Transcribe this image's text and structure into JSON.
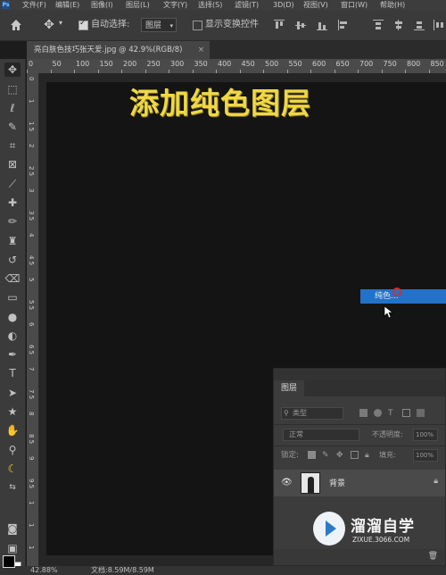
{
  "menubar": {
    "items": [
      "文件(F)",
      "编辑(E)",
      "图像(I)",
      "图层(L)",
      "文字(Y)",
      "选择(S)",
      "滤镜(T)",
      "3D(D)",
      "视图(V)",
      "窗口(W)",
      "帮助(H)"
    ]
  },
  "options": {
    "auto_select_label": "自动选择:",
    "auto_select_value": "图层",
    "transform_controls_label": "显示变换控件"
  },
  "document": {
    "tab_title": "亮白肤色技巧张天爱.jpg @ 42.9%(RGB/8)",
    "close_glyph": "×"
  },
  "ruler": {
    "h_ticks": [
      "0",
      "50",
      "100",
      "150",
      "200",
      "250",
      "300",
      "350",
      "400",
      "450",
      "500",
      "550",
      "600",
      "650",
      "700",
      "750",
      "800",
      "850",
      "900",
      "950",
      "1000",
      "1050",
      "1100",
      "1150"
    ],
    "v_ticks": [
      "0",
      "1",
      "1 5",
      "2",
      "2 5",
      "3",
      "3 5",
      "4",
      "4 5",
      "5",
      "5 5",
      "6",
      "6 5",
      "7",
      "7 5",
      "8",
      "8 5",
      "9",
      "9 5",
      "1",
      "1",
      "1"
    ]
  },
  "canvas": {
    "headline": "添加纯色图层",
    "headline_color": "#f0d846"
  },
  "popup": {
    "item_label": "纯色..."
  },
  "layers_panel": {
    "tab_label": "图层",
    "filter_label": "类型",
    "blend_mode": "正常",
    "opacity_label": "不透明度:",
    "opacity_value": "100%",
    "lock_label": "锁定:",
    "fill_label": "填充:",
    "fill_value": "100%",
    "layer_name": "背景"
  },
  "watermark": {
    "brand": "溜溜自学",
    "site": "ZIXUE.3066.COM"
  },
  "status": {
    "zoom": "42.88%",
    "doc_size": "文档:8.59M/8.59M"
  },
  "colors": {
    "accent": "#2372c9",
    "canvas": "#141414",
    "panel": "#3c3c3c"
  }
}
